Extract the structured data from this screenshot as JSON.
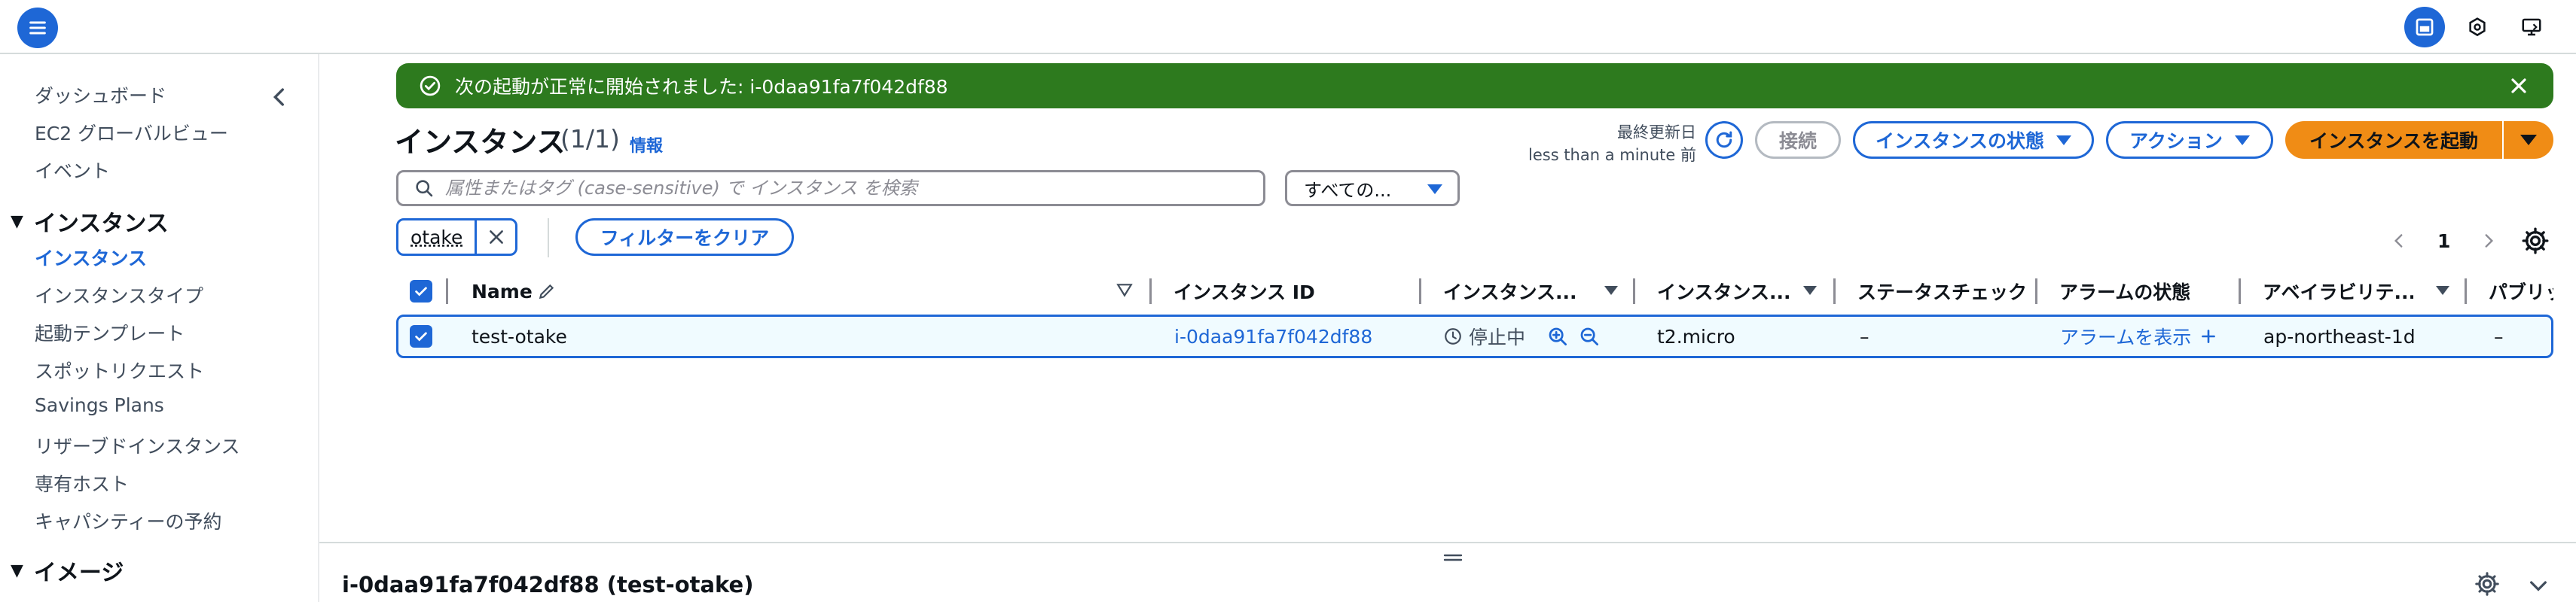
{
  "sidebar": {
    "top_items": [
      "ダッシュボード",
      "EC2 グローバルビュー",
      "イベント"
    ],
    "section_instances": "インスタンス",
    "instance_items": [
      "インスタンス",
      "インスタンスタイプ",
      "起動テンプレート",
      "スポットリクエスト",
      "Savings Plans",
      "リザーブドインスタンス",
      "専有ホスト",
      "キャパシティーの予約"
    ],
    "section_images": "イメージ"
  },
  "flash": {
    "message": "次の起動が正常に開始されました: i-0daa91fa7f042df88",
    "color": "#2d7a1e"
  },
  "header": {
    "title": "インスタンス",
    "count": "(1/1)",
    "info": "情報",
    "last_updated_label": "最終更新日",
    "last_updated_value": "less than a minute 前",
    "connect": "接続",
    "instance_state": "インスタンスの状態",
    "actions": "アクション",
    "launch": "インスタンスを起動"
  },
  "search": {
    "placeholder": "属性またはタグ (case-sensitive) で インスタンス を検索",
    "value": "",
    "scope": "すべての..."
  },
  "filter": {
    "token": "otake",
    "clear": "フィルターをクリア"
  },
  "pagination": {
    "page": "1"
  },
  "table": {
    "headers": [
      "Name",
      "インスタンス ID",
      "インスタンス...",
      "インスタンス...",
      "ステータスチェック",
      "アラームの状態",
      "アベイラビリテ...",
      "パブリッ"
    ],
    "row": {
      "name": "test-otake",
      "instance_id": "i-0daa91fa7f042df88",
      "state": "停止中",
      "type": "t2.micro",
      "status_check": "–",
      "alarm": "アラームを表示",
      "az": "ap-northeast-1d",
      "public": "–"
    }
  },
  "split_panel": {
    "title": "i-0daa91fa7f042df88 (test-otake)"
  },
  "colors": {
    "accent": "#1e67d6",
    "launch": "#f08c15",
    "success": "#2d7a1e"
  }
}
